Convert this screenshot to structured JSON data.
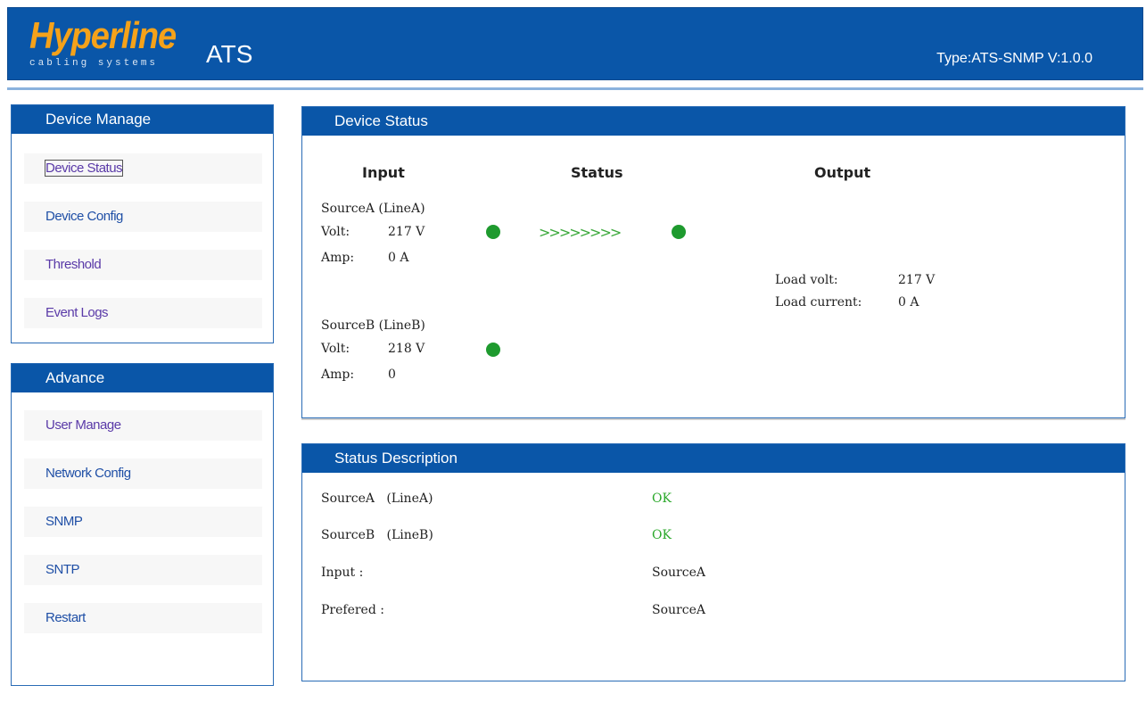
{
  "header": {
    "logo": "Hyperline",
    "logo_sub": "cabling systems",
    "title": "ATS",
    "version": "Type:ATS-SNMP V:1.0.0"
  },
  "sidebar": {
    "device_manage": {
      "title": "Device Manage",
      "items": [
        {
          "label": "Device Status"
        },
        {
          "label": "Device Config"
        },
        {
          "label": "Threshold"
        },
        {
          "label": "Event Logs"
        }
      ]
    },
    "advance": {
      "title": "Advance",
      "items": [
        {
          "label": "User Manage"
        },
        {
          "label": "Network Config"
        },
        {
          "label": "SNMP"
        },
        {
          "label": "SNTP"
        },
        {
          "label": "Restart"
        }
      ]
    }
  },
  "device_status": {
    "title": "Device Status",
    "col_input": "Input",
    "col_status": "Status",
    "col_output": "Output",
    "source_a": {
      "name": "SourceA (LineA)",
      "volt_label": "Volt:",
      "volt_value": "217 V",
      "amp_label": "Amp:",
      "amp_value": "0 A"
    },
    "source_b": {
      "name": "SourceB (LineB)",
      "volt_label": "Volt:",
      "volt_value": "218 V",
      "amp_label": "Amp:",
      "amp_value": "0"
    },
    "transfer_arrows": ">>>>>>>>",
    "output": {
      "load_volt_label": "Load volt:",
      "load_volt_value": "217 V",
      "load_current_label": "Load current:",
      "load_current_value": "0 A"
    },
    "led_color": "#1e9a2e"
  },
  "status_description": {
    "title": "Status Description",
    "rows": [
      {
        "label": "SourceA   (LineA)",
        "value": "OK"
      },
      {
        "label": "SourceB   (LineB)",
        "value": "OK"
      },
      {
        "label": "Input :",
        "value": "SourceA"
      },
      {
        "label": "Prefered :",
        "value": "SourceA"
      }
    ]
  }
}
